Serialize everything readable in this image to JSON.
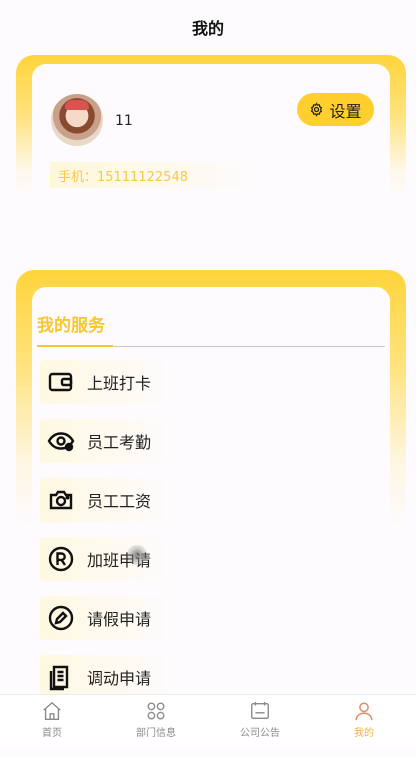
{
  "header": {
    "title": "我的"
  },
  "profile": {
    "username": "11",
    "settings_label": "设置",
    "phone": "手机：15111122548"
  },
  "services": {
    "title": "我的服务",
    "items": [
      {
        "label": "上班打卡",
        "icon": "wallet-icon"
      },
      {
        "label": "员工考勤",
        "icon": "eye-icon"
      },
      {
        "label": "员工工资",
        "icon": "camera-icon"
      },
      {
        "label": "加班申请",
        "icon": "registered-icon"
      },
      {
        "label": "请假申请",
        "icon": "pencil-circle-icon"
      },
      {
        "label": "调动申请",
        "icon": "document-icon"
      }
    ]
  },
  "tabbar": {
    "items": [
      {
        "label": "首页",
        "icon": "home-icon"
      },
      {
        "label": "部门信息",
        "icon": "grid-icon"
      },
      {
        "label": "公司公告",
        "icon": "board-icon"
      },
      {
        "label": "我的",
        "icon": "user-icon",
        "active": true
      }
    ]
  },
  "colors": {
    "accent": "#ffcf2e",
    "accent_text": "#f7c631",
    "active_tab": "#f0b04a"
  }
}
